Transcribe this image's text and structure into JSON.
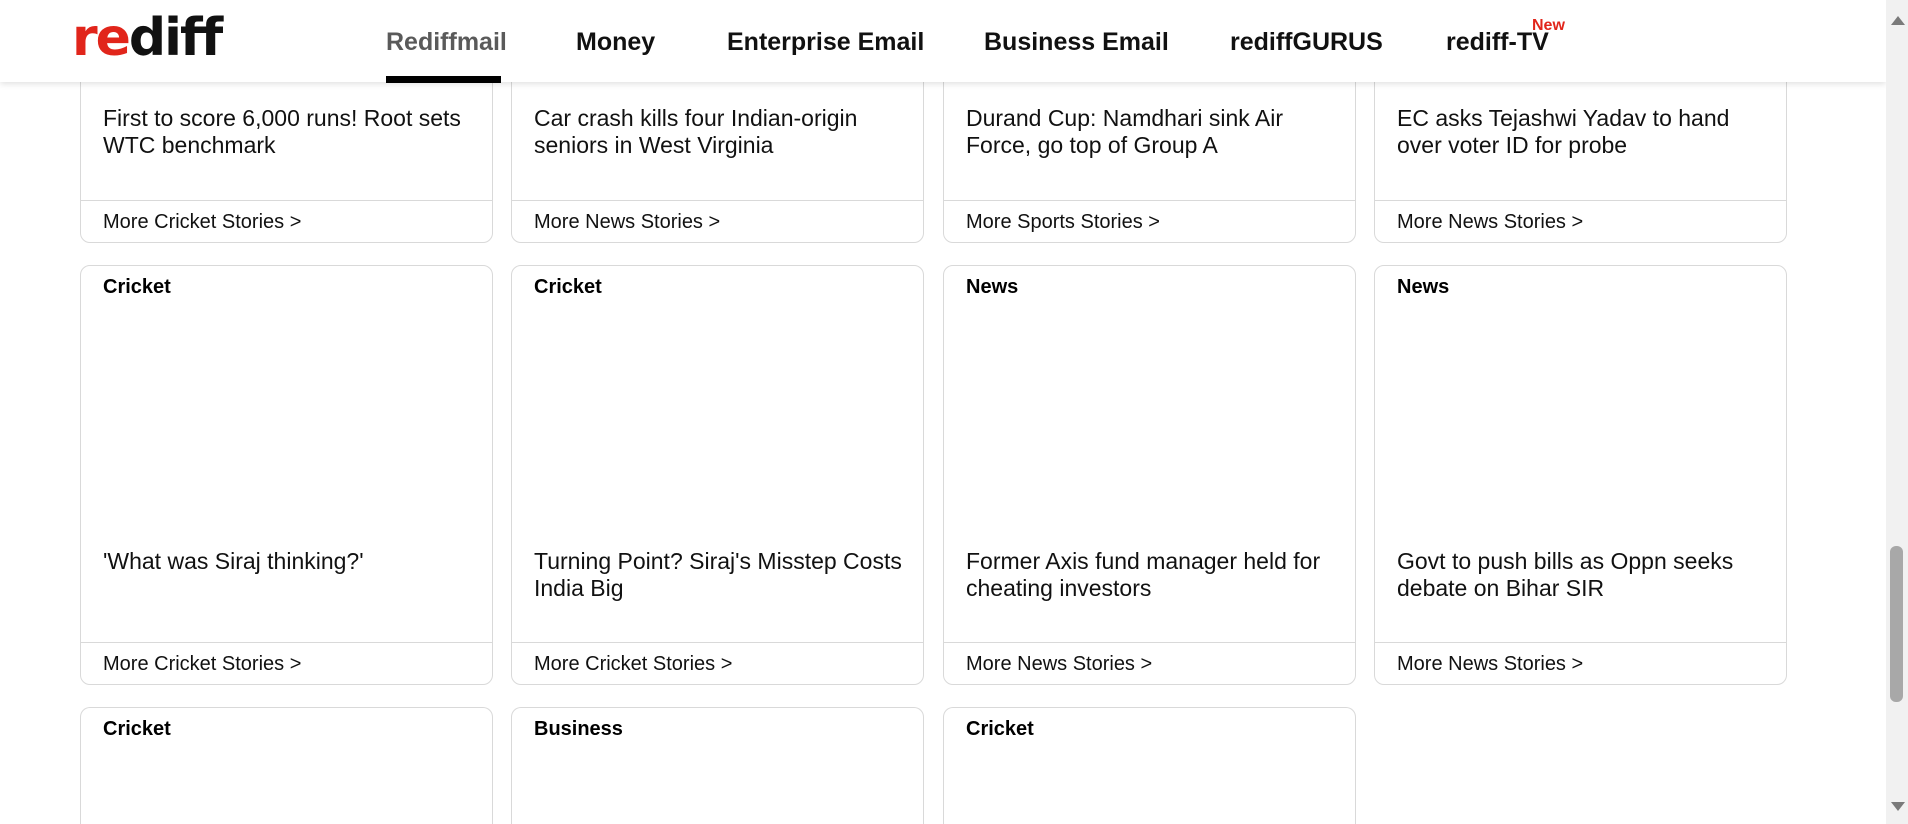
{
  "logo": {
    "part1": "re",
    "part2": "diff"
  },
  "nav": {
    "items": [
      "Rediffmail",
      "Money",
      "Enterprise Email",
      "Business Email",
      "rediffGURUS",
      "rediff-TV"
    ],
    "badge": "New"
  },
  "cards": {
    "row1": [
      {
        "headline": "First to score 6,000 runs! Root sets WTC benchmark",
        "more": "More Cricket Stories >"
      },
      {
        "headline": "Car crash kills four Indian-origin seniors in West Virginia",
        "more": "More News Stories >"
      },
      {
        "headline": "Durand Cup: Namdhari sink Air Force, go top of Group A",
        "more": "More Sports Stories >"
      },
      {
        "headline": "EC asks Tejashwi Yadav to hand over voter ID for probe",
        "more": "More News Stories >"
      }
    ],
    "row2": [
      {
        "category": "Cricket",
        "headline": "'What was Siraj thinking?'",
        "more": "More Cricket Stories >"
      },
      {
        "category": "Cricket",
        "headline": "Turning Point? Siraj's Misstep Costs India Big",
        "more": "More Cricket Stories >"
      },
      {
        "category": "News",
        "headline": "Former Axis fund manager held for cheating investors",
        "more": "More News Stories >"
      },
      {
        "category": "News",
        "headline": "Govt to push bills as Oppn seeks debate on Bihar SIR",
        "more": "More News Stories >"
      }
    ],
    "row3": [
      {
        "category": "Cricket"
      },
      {
        "category": "Business"
      },
      {
        "category": "Cricket"
      }
    ]
  }
}
